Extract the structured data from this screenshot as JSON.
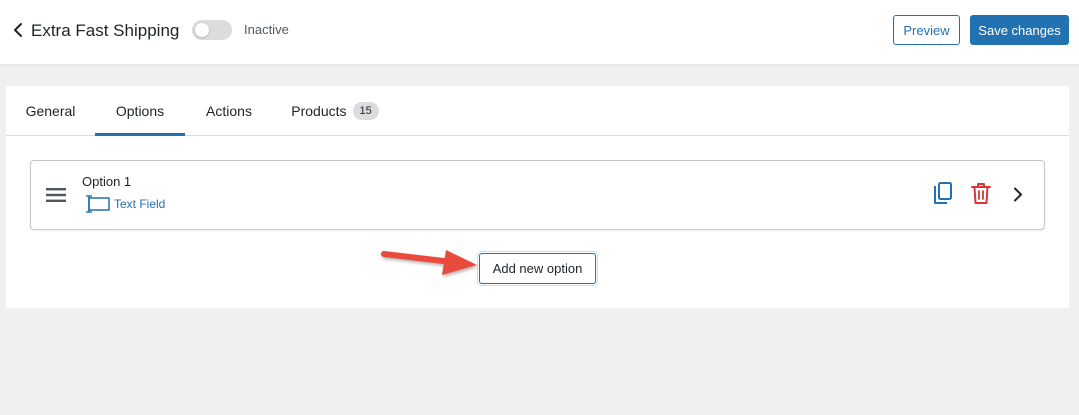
{
  "header": {
    "title": "Extra Fast Shipping",
    "status": "Inactive",
    "toggle_on": false,
    "preview_label": "Preview",
    "save_label": "Save changes"
  },
  "tabs": [
    {
      "label": "General",
      "active": false
    },
    {
      "label": "Options",
      "active": true
    },
    {
      "label": "Actions",
      "active": false
    },
    {
      "label": "Products",
      "active": false,
      "badge": "15"
    }
  ],
  "options": [
    {
      "title": "Option 1",
      "type": "Text Field",
      "type_icon": "text-field-icon"
    }
  ],
  "add_option_label": "Add new option",
  "colors": {
    "accent": "#2271b1",
    "danger": "#d63638",
    "arrow": "#e84c3d",
    "background": "#f0f0f1"
  }
}
